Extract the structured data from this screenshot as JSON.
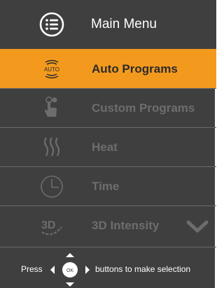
{
  "header": {
    "title": "Main Menu",
    "icon": "list-menu-icon"
  },
  "menu": {
    "items": [
      {
        "label": "Auto Programs",
        "icon": "auto-programs-icon",
        "selected": true
      },
      {
        "label": "Custom Programs",
        "icon": "touch-hand-icon",
        "selected": false
      },
      {
        "label": "Heat",
        "icon": "heat-waves-icon",
        "selected": false
      },
      {
        "label": "Time",
        "icon": "clock-icon",
        "selected": false
      },
      {
        "label": "3D Intensity",
        "icon": "3d-intensity-icon",
        "selected": false
      }
    ],
    "scroll_icon": "chevron-down-icon"
  },
  "auto_icon_text": "AUTO",
  "three_d_icon_text": "3D",
  "footer": {
    "press": "Press",
    "ok_label": "OK",
    "after": "buttons to make selection"
  },
  "colors": {
    "background": "#3f3f3f",
    "accent": "#f39a1e",
    "inactive_text": "#6d6d6d",
    "divider": "#6a6a6a"
  }
}
